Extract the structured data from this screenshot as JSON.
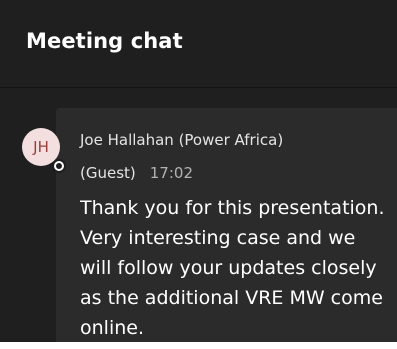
{
  "header": {
    "title": "Meeting chat"
  },
  "message": {
    "avatar_initials": "JH",
    "sender": "Joe Hallahan (Power Africa)",
    "role": "(Guest)",
    "time": "17:02",
    "lines": [
      "Thank you for this presentation.",
      "Very interesting case and we",
      "will follow your updates closely",
      "as the additional VRE MW come",
      "online."
    ]
  },
  "icons": {
    "presence": "presence-status-icon"
  },
  "colors": {
    "panel_background": "#1f1f1f",
    "message_background": "#2b2b2b",
    "avatar_background": "#f3dfe0",
    "avatar_initials": "#9a3f3a",
    "text_primary": "#ffffff",
    "text_secondary": "#b3b3b3"
  }
}
